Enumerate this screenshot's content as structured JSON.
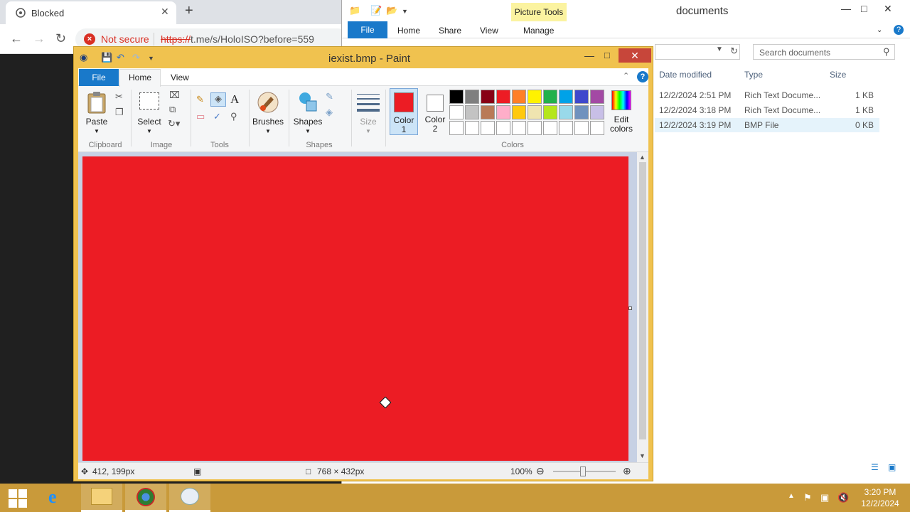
{
  "browser": {
    "tab_title": "Blocked",
    "security_label": "Not secure",
    "url_scheme": "https://",
    "url_rest": "t.me/s/HoloISO?before=559",
    "newtab_glyph": "+",
    "close_glyph": "✕"
  },
  "explorer": {
    "window_title": "documents",
    "contextual_tab": "Picture Tools",
    "tabs": [
      "File",
      "Home",
      "Share",
      "View",
      "Manage"
    ],
    "search_placeholder": "Search documents",
    "columns": {
      "date": "Date modified",
      "type": "Type",
      "size": "Size"
    },
    "files": [
      {
        "date": "12/2/2024 2:51 PM",
        "type": "Rich Text Docume...",
        "size": "1 KB"
      },
      {
        "date": "12/2/2024 3:18 PM",
        "type": "Rich Text Docume...",
        "size": "1 KB"
      },
      {
        "date": "12/2/2024 3:19 PM",
        "type": "BMP File",
        "size": "0 KB"
      }
    ]
  },
  "paint": {
    "window_title": "iexist.bmp - Paint",
    "tabs": {
      "file": "File",
      "home": "Home",
      "view": "View"
    },
    "help_glyph": "?",
    "ribbon": {
      "paste": "Paste",
      "clipboard": "Clipboard",
      "select": "Select",
      "image": "Image",
      "tools": "Tools",
      "brushes": "Brushes",
      "shapes": "Shapes",
      "shapes_group": "Shapes",
      "size": "Size",
      "color1_a": "Color",
      "color1_b": "1",
      "color2_a": "Color",
      "color2_b": "2",
      "colors_group": "Colors",
      "edit_colors_a": "Edit",
      "edit_colors_b": "colors",
      "text_tool": "A"
    },
    "color1": "#ec1c24",
    "color2": "#ffffff",
    "palette_row1": [
      "#000000",
      "#7f7f7f",
      "#880015",
      "#ed1c24",
      "#ff7f27",
      "#fff200",
      "#22b14c",
      "#00a2e8",
      "#3f48cc",
      "#a349a4"
    ],
    "palette_row2": [
      "#ffffff",
      "#c3c3c3",
      "#b97a57",
      "#ffaec9",
      "#ffc90e",
      "#efe4b0",
      "#b5e61d",
      "#99d9ea",
      "#7092be",
      "#c8bfe7"
    ],
    "canvas_color": "#ec1c24",
    "status": {
      "cursor_pos": "412, 199px",
      "image_size": "768 × 432px",
      "zoom": "100%"
    }
  },
  "taskbar": {
    "time": "3:20 PM",
    "date": "12/2/2024"
  }
}
